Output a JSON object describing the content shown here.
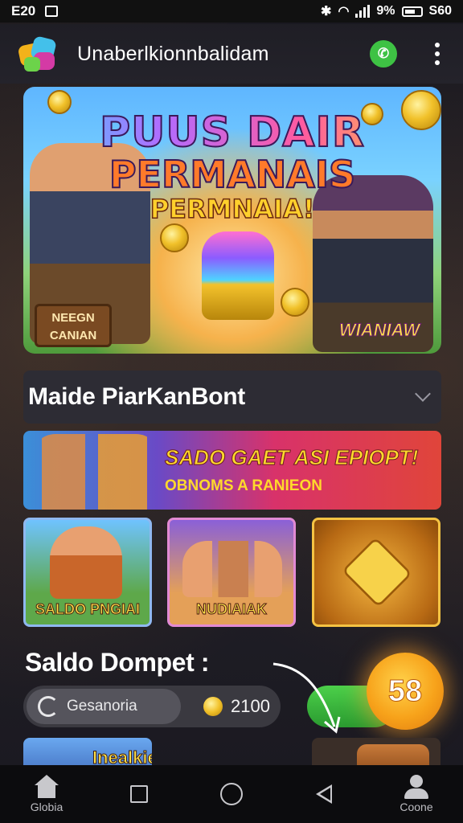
{
  "status_bar": {
    "time": "E20",
    "battery_text": "9%",
    "network_text": "S60"
  },
  "app_bar": {
    "title": "Unaberlkionnbalidam",
    "whatsapp_icon": "whatsapp-icon",
    "menu_icon": "kebab-menu-icon"
  },
  "hero": {
    "title_line1": "PUUS DAIR",
    "title_line2": "PERMANAIS",
    "title_line3": "PERMNAIA!",
    "sign_left": "NEEGN CANIAN",
    "sign_right": "WIANIAW"
  },
  "select": {
    "value": "Maide PiarKanBont"
  },
  "promo": {
    "title": "SADO GAET ASI EPIOPT!",
    "subtitle": "OBNOMS A RANIEON"
  },
  "tiles": [
    {
      "label": "SALDO PNGIAI"
    },
    {
      "label": "NUDIAIAK"
    },
    {
      "label": ""
    }
  ],
  "wallet": {
    "title": "Saldo Dompet :",
    "button_label": "Gesanoria",
    "amount": "2100"
  },
  "floating_badge": {
    "value": "58"
  },
  "bottom_card": {
    "label": "Inealkiet"
  },
  "nav": {
    "home_label": "Globia",
    "profile_label": "Coone"
  },
  "colors": {
    "background": "#1c1b22",
    "accent_green": "#3ec244",
    "accent_orange": "#f7a21a",
    "accent_yellow": "#ffd92c"
  }
}
